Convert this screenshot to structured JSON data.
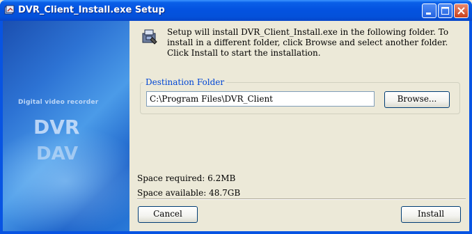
{
  "window": {
    "title": "DVR_Client_Install.exe Setup"
  },
  "banner": {
    "subtitle": "Digital video recorder",
    "logo_top": "DVR",
    "logo_bottom": "DAV"
  },
  "intro": {
    "text": "Setup will install DVR_Client_Install.exe in the following folder. To install in a different folder, click Browse and select another folder. Click Install to start the installation."
  },
  "destination": {
    "group_label": "Destination Folder",
    "path": "C:\\Program Files\\DVR_Client",
    "browse_label": "Browse..."
  },
  "space": {
    "required": "Space required: 6.2MB",
    "available": "Space available: 48.7GB"
  },
  "buttons": {
    "cancel": "Cancel",
    "install": "Install"
  },
  "colors": {
    "titlebar": "#0453e0",
    "dialog_bg": "#ece9d8",
    "group_label": "#0046d5"
  }
}
